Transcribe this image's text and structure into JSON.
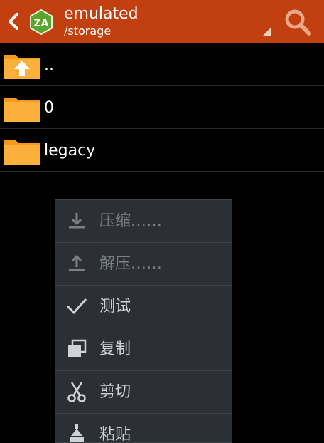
{
  "actionbar": {
    "title": "emulated",
    "subtitle": "/storage",
    "colors": {
      "bar": "#c2400f",
      "logo": "#5aa52c"
    },
    "icons": {
      "back": "chevron-left-icon",
      "logo": "zarchiver-logo-icon",
      "search": "search-icon",
      "dropdown": "dropdown-triangle-icon"
    }
  },
  "files": [
    {
      "name": "..",
      "icon": "folder-up-icon"
    },
    {
      "name": "0",
      "icon": "folder-icon"
    },
    {
      "name": "legacy",
      "icon": "folder-icon"
    }
  ],
  "context_menu": {
    "items": [
      {
        "label": "压缩……",
        "icon": "download-arrow-icon",
        "enabled": false
      },
      {
        "label": "解压……",
        "icon": "upload-arrow-icon",
        "enabled": false
      },
      {
        "label": "测试",
        "icon": "checkmark-icon",
        "enabled": true
      },
      {
        "label": "复制",
        "icon": "copy-icon",
        "enabled": true
      },
      {
        "label": "剪切",
        "icon": "scissors-icon",
        "enabled": true
      },
      {
        "label": "粘贴",
        "icon": "paste-icon",
        "enabled": true
      }
    ]
  }
}
